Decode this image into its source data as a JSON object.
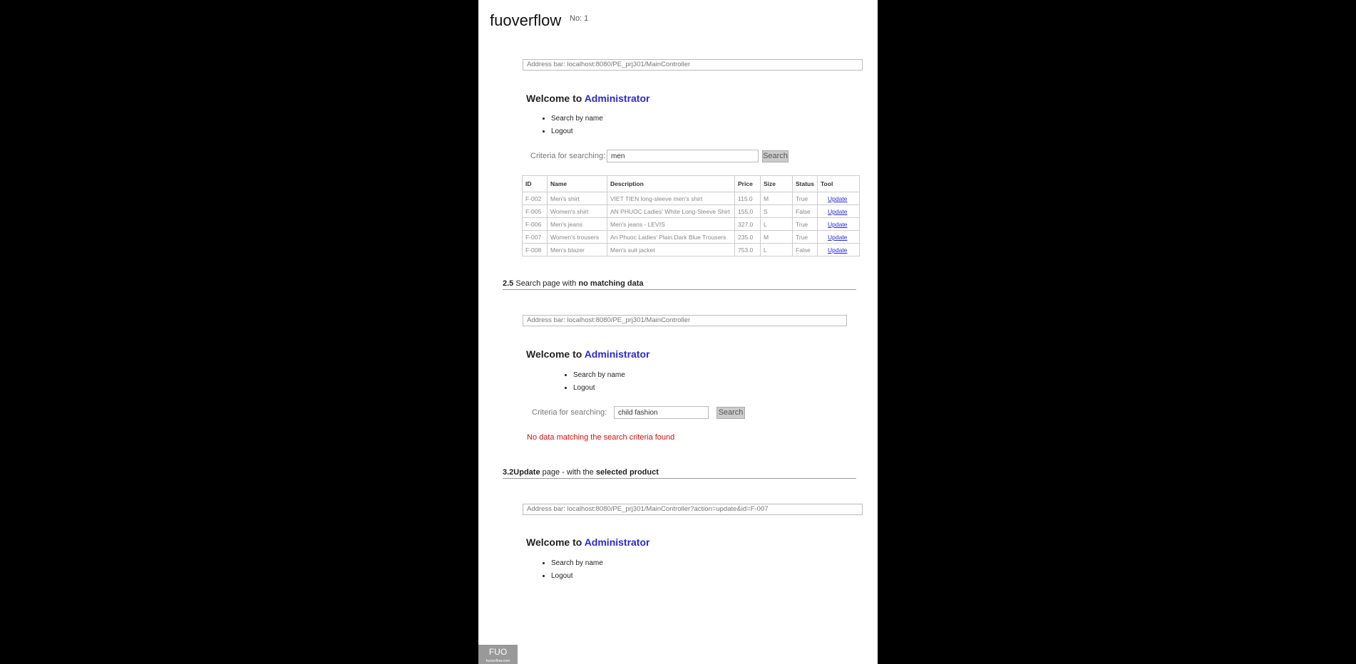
{
  "brand": "fuoverflow",
  "question_no": "No: 1",
  "s1": {
    "address": "Address bar: localhost:8080/PE_prj301/MainController",
    "welcome_prefix": "Welcome to",
    "welcome_user": "Administrator",
    "menu": [
      "Search by name",
      "Logout"
    ],
    "criteria_label": "Criteria for searching:",
    "search_value": "men",
    "search_button": "Search",
    "table": {
      "headers": [
        "ID",
        "Name",
        "Description",
        "Price",
        "Size",
        "Status",
        "Tool"
      ],
      "rows": [
        [
          "F-002",
          "Men's shirt",
          "VIET TIEN long-sleeve men's shirt",
          "115.0",
          "M",
          "True",
          "Update"
        ],
        [
          "F-005",
          "Women's shirt",
          "AN PHUOC Ladies' White Long-Sleeve Shirt",
          "155.0",
          "S",
          "False",
          "Update"
        ],
        [
          "F-006",
          "Men's jeans",
          "Men's jeans - LEVIS",
          "327.0",
          "L",
          "True",
          "Update"
        ],
        [
          "F-007",
          "Women's trousers",
          "An Phuoc Ladies' Plain Dark Blue Trousers",
          "235.0",
          "M",
          "True",
          "Update"
        ],
        [
          "F-008",
          "Men's blazer",
          "Men's suit jacket",
          "753.0",
          "L",
          "False",
          "Update"
        ]
      ]
    }
  },
  "s2": {
    "heading_num": "2.5",
    "heading_text": " Search page with ",
    "heading_bold": "no matching data",
    "address": "Address bar: localhost:8080/PE_prj301/MainController",
    "welcome_prefix": "Welcome to",
    "welcome_user": "Administrator",
    "menu": [
      "Search by name",
      "Logout"
    ],
    "criteria_label": "Criteria for searching:",
    "search_value": "child fashion",
    "search_button": "Search",
    "no_data": "No data matching the search criteria found"
  },
  "s3": {
    "heading_num": "3.2Update",
    "heading_text": " page - with the ",
    "heading_bold": "selected product",
    "address": "Address bar: localhost:8080/PE_prj301/MainController?action=update&id=F-007",
    "welcome_prefix": "Welcome to",
    "welcome_user": "Administrator",
    "menu": [
      "Search by name",
      "Logout"
    ]
  },
  "logo": {
    "text": "FUO",
    "sub": "fuoverflow.com"
  }
}
